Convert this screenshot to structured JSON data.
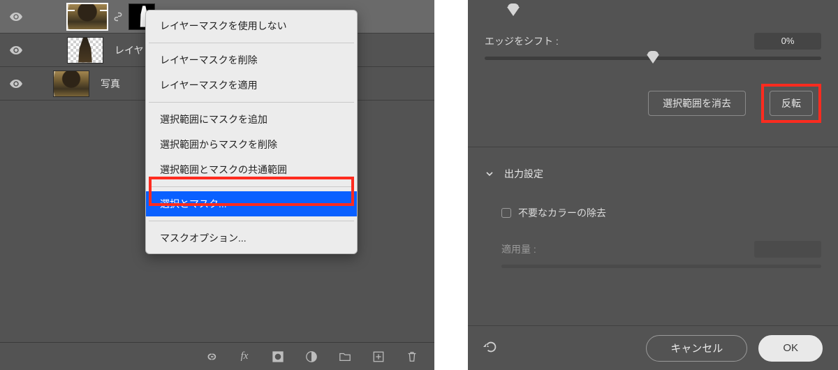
{
  "layers": {
    "row1_name_visible": false,
    "row2_name": "レイヤ",
    "row3_name": "写真"
  },
  "context_menu": {
    "items": [
      "レイヤーマスクを使用しない",
      "レイヤーマスクを削除",
      "レイヤーマスクを適用",
      "選択範囲にマスクを追加",
      "選択範囲からマスクを削除",
      "選択範囲とマスクの共通範囲",
      "選択とマスク...",
      "マスクオプション..."
    ]
  },
  "right_panel": {
    "edge_shift_label": "エッジをシフト :",
    "edge_shift_value": "0%",
    "clear_selection_btn": "選択範囲を消去",
    "invert_btn": "反転",
    "output_section_title": "出力設定",
    "decontaminate_label": "不要なカラーの除去",
    "amount_label": "適用量 :",
    "cancel_btn": "キャンセル",
    "ok_btn": "OK"
  }
}
